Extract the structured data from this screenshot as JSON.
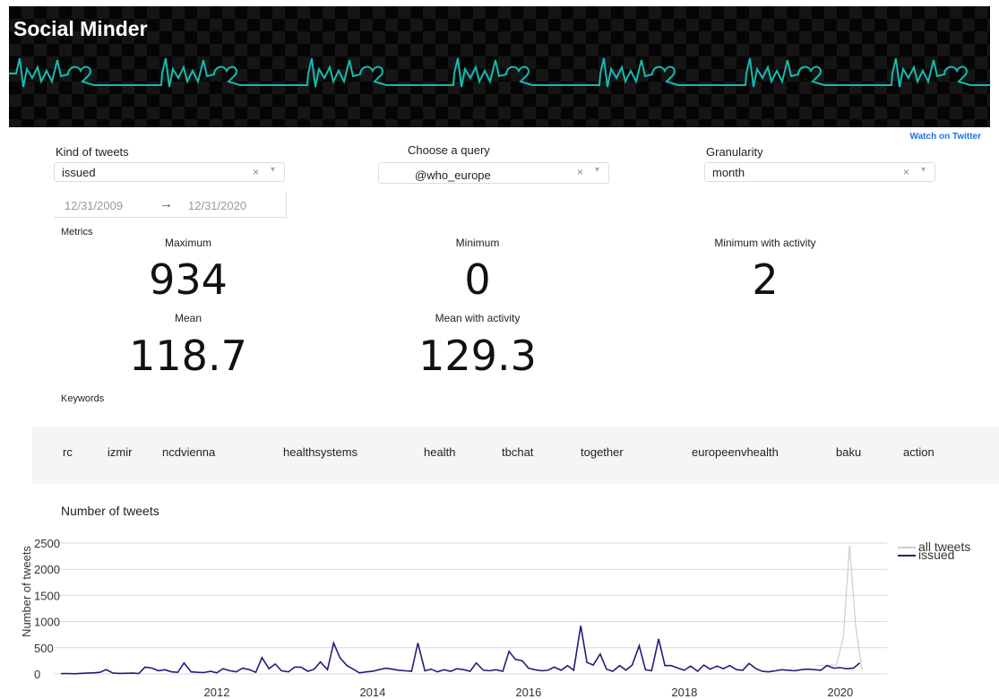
{
  "header": {
    "title": "Social Minder",
    "watch_link": "Watch on Twitter"
  },
  "filters": {
    "kind": {
      "label": "Kind of tweets",
      "value": "issued",
      "clear": "×",
      "arrow": "▾"
    },
    "query": {
      "label": "Choose a query",
      "value": "@who_europe",
      "clear": "×",
      "arrow": "▾"
    },
    "granularity": {
      "label": "Granularity",
      "value": "month",
      "clear": "×",
      "arrow": "▾"
    },
    "date_start": "12/31/2009",
    "date_arrow": "→",
    "date_end": "12/31/2020"
  },
  "metrics": {
    "section_label": "Metrics",
    "maximum": {
      "label": "Maximum",
      "value": "934"
    },
    "minimum": {
      "label": "Minimum",
      "value": "0"
    },
    "min_activity": {
      "label": "Minimum with activity",
      "value": "2"
    },
    "mean": {
      "label": "Mean",
      "value": "118.7"
    },
    "mean_activity": {
      "label": "Mean with activity",
      "value": "129.3"
    }
  },
  "keywords": {
    "section_label": "Keywords",
    "items": [
      "rc",
      "izmir",
      "ncdvienna",
      "healthsystems",
      "health",
      "tbchat",
      "together",
      "europeenvhealth",
      "baku",
      "action"
    ]
  },
  "chart_title": "Number of tweets",
  "chart_data": {
    "type": "line",
    "title": "",
    "ylabel": "Number of tweets",
    "xlabel": "",
    "ylim": [
      0,
      2500
    ],
    "xlim": [
      2010.0,
      2020.6
    ],
    "yticks": [
      0,
      500,
      1000,
      1500,
      2000,
      2500
    ],
    "xticks": [
      2012,
      2014,
      2016,
      2018,
      2020
    ],
    "grid": true,
    "legend_placement": "top-right",
    "series": [
      {
        "name": "all tweets",
        "color": "#cccccc",
        "x": [
          2019.7,
          2019.95,
          2020.04,
          2020.12,
          2020.2,
          2020.28
        ],
        "values": [
          160,
          170,
          700,
          2450,
          900,
          60
        ]
      },
      {
        "name": "issued",
        "color": "#2a1a7a",
        "x": [
          2010.0,
          2010.08,
          2010.17,
          2010.25,
          2010.33,
          2010.42,
          2010.5,
          2010.58,
          2010.67,
          2010.75,
          2010.83,
          2010.92,
          2011.0,
          2011.08,
          2011.17,
          2011.25,
          2011.33,
          2011.42,
          2011.5,
          2011.58,
          2011.67,
          2011.75,
          2011.83,
          2011.92,
          2012.0,
          2012.08,
          2012.17,
          2012.25,
          2012.33,
          2012.42,
          2012.5,
          2012.58,
          2012.67,
          2012.75,
          2012.83,
          2012.92,
          2013.0,
          2013.08,
          2013.17,
          2013.25,
          2013.33,
          2013.42,
          2013.5,
          2013.58,
          2013.67,
          2013.75,
          2013.83,
          2013.92,
          2014.0,
          2014.08,
          2014.17,
          2014.25,
          2014.33,
          2014.42,
          2014.5,
          2014.58,
          2014.67,
          2014.75,
          2014.83,
          2014.92,
          2015.0,
          2015.08,
          2015.17,
          2015.25,
          2015.33,
          2015.42,
          2015.5,
          2015.58,
          2015.67,
          2015.75,
          2015.83,
          2015.92,
          2016.0,
          2016.08,
          2016.17,
          2016.25,
          2016.33,
          2016.42,
          2016.5,
          2016.58,
          2016.67,
          2016.75,
          2016.83,
          2016.92,
          2017.0,
          2017.08,
          2017.17,
          2017.25,
          2017.33,
          2017.42,
          2017.5,
          2017.58,
          2017.67,
          2017.75,
          2017.83,
          2017.92,
          2018.0,
          2018.08,
          2018.17,
          2018.25,
          2018.33,
          2018.42,
          2018.5,
          2018.58,
          2018.67,
          2018.75,
          2018.83,
          2018.92,
          2019.0,
          2019.08,
          2019.17,
          2019.25,
          2019.33,
          2019.42,
          2019.5,
          2019.58,
          2019.67,
          2019.75,
          2019.83,
          2019.92,
          2020.0,
          2020.08,
          2020.17,
          2020.25
        ],
        "values": [
          5,
          8,
          3,
          10,
          15,
          20,
          30,
          80,
          15,
          10,
          12,
          15,
          8,
          130,
          110,
          60,
          80,
          40,
          30,
          210,
          40,
          30,
          25,
          50,
          20,
          100,
          60,
          40,
          110,
          80,
          30,
          310,
          100,
          190,
          60,
          40,
          130,
          130,
          50,
          90,
          230,
          80,
          590,
          310,
          160,
          90,
          20,
          40,
          50,
          80,
          110,
          90,
          70,
          60,
          50,
          590,
          60,
          90,
          40,
          80,
          50,
          100,
          80,
          50,
          210,
          70,
          60,
          80,
          50,
          430,
          280,
          250,
          110,
          80,
          60,
          70,
          130,
          70,
          160,
          70,
          920,
          220,
          170,
          380,
          90,
          50,
          160,
          70,
          170,
          540,
          80,
          60,
          670,
          160,
          160,
          110,
          70,
          150,
          50,
          170,
          90,
          150,
          100,
          160,
          80,
          70,
          200,
          100,
          50,
          40,
          60,
          80,
          70,
          60,
          80,
          90,
          80,
          70,
          160,
          110,
          120,
          100,
          110,
          210
        ]
      }
    ]
  }
}
